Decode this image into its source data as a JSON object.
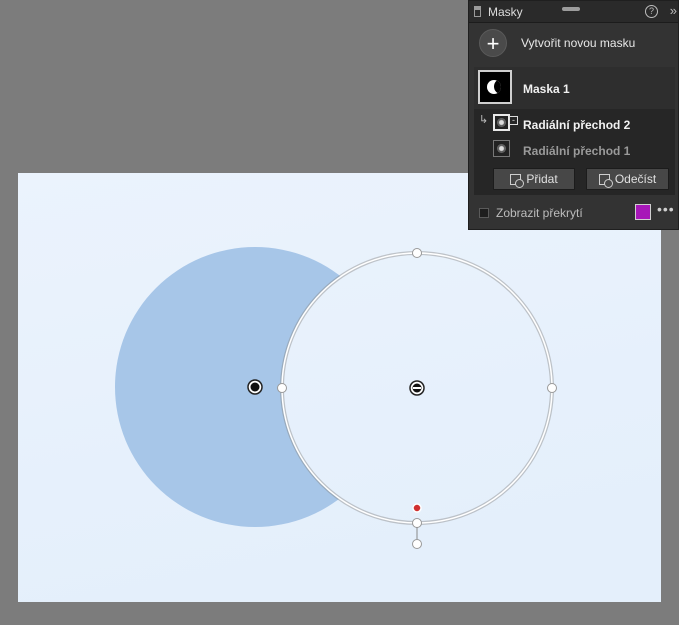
{
  "panel": {
    "title": "Masky",
    "create_mask_label": "Vytvořit novou masku",
    "mask": {
      "name": "Maska 1"
    },
    "components": [
      {
        "label": "Radiální přechod 2",
        "selected": true,
        "mode": "subtract"
      },
      {
        "label": "Radiální přechod 1",
        "selected": false,
        "mode": "add"
      }
    ],
    "add_button_label": "Přidat",
    "subtract_button_label": "Odečíst",
    "show_overlay_label": "Zobrazit překrytí",
    "show_overlay_checked": false,
    "overlay_color": "#a717b8",
    "icons": {
      "panel": "document-icon",
      "help": "help-icon",
      "collapse": "collapse-icon",
      "add_mask": "plus-icon",
      "more": "more-icon"
    }
  },
  "canvas": {
    "background_color": "#e8f2fd",
    "mask_overlay_color": "#a7c6e8",
    "pin_color_selected": "#1a1a1a",
    "pin_color_center": "#ffffff",
    "feather_marker_color": "#d03030"
  }
}
